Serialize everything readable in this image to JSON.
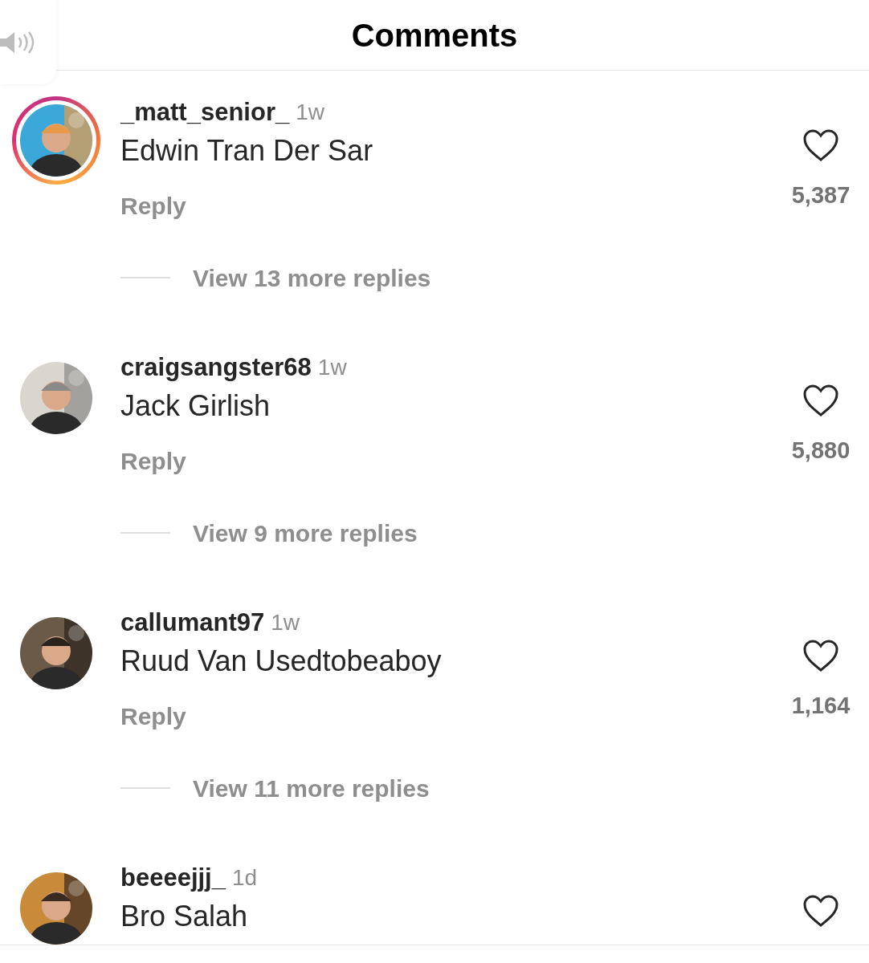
{
  "header": {
    "title": "Comments"
  },
  "comments": [
    {
      "username": "_matt_senior_",
      "time": "1w",
      "text": "Edwin Tran Der Sar",
      "story_ring": true,
      "reply": "Reply",
      "likes": "5,387",
      "view_replies": "View 13 more replies"
    },
    {
      "username": "craigsangster68",
      "time": "1w",
      "text": "Jack Girlish",
      "story_ring": false,
      "reply": "Reply",
      "likes": "5,880",
      "view_replies": "View 9 more replies"
    },
    {
      "username": "callumant97",
      "time": "1w",
      "text": "Ruud Van Usedtobeaboy",
      "story_ring": false,
      "reply": "Reply",
      "likes": "1,164",
      "view_replies": "View 11 more replies"
    },
    {
      "username": "beeeejjj_",
      "time": "1d",
      "text": "Bro Salah",
      "story_ring": false
    }
  ]
}
